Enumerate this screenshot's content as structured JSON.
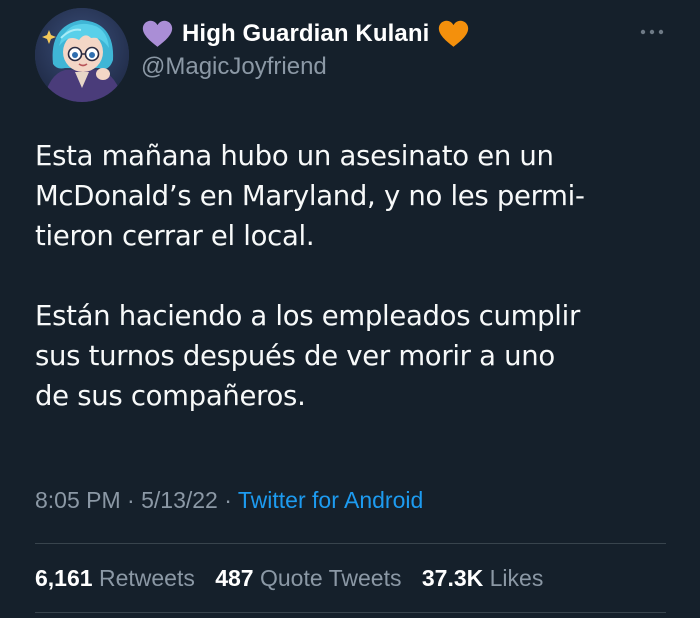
{
  "author": {
    "display_name": "High Guardian Kulani",
    "handle": "@MagicJoyfriend",
    "name_prefix_icon": "purple-heart-icon",
    "name_suffix_icon": "orange-heart-icon"
  },
  "tweet": {
    "lines_p1": [
      "Esta mañana hubo un asesinato en un",
      "McDonald’s en Maryland, y no les permi-",
      "tieron cerrar el local."
    ],
    "lines_p2": [
      "Están haciendo a los empleados cumplir",
      "sus turnos después de ver morir a uno",
      "de sus compañeros."
    ]
  },
  "meta": {
    "time": "8:05 PM",
    "date": "5/13/22",
    "separator": "·",
    "source": "Twitter for Android"
  },
  "stats": {
    "retweets_count": "6,161",
    "retweets_label": "Retweets",
    "quotes_count": "487",
    "quotes_label": "Quote Tweets",
    "likes_count": "37.3K",
    "likes_label": "Likes"
  },
  "colors": {
    "background": "#15202b",
    "text_primary": "#ffffff",
    "text_secondary": "#8b98a5",
    "link": "#1d9bf0",
    "divider": "#38444d"
  }
}
